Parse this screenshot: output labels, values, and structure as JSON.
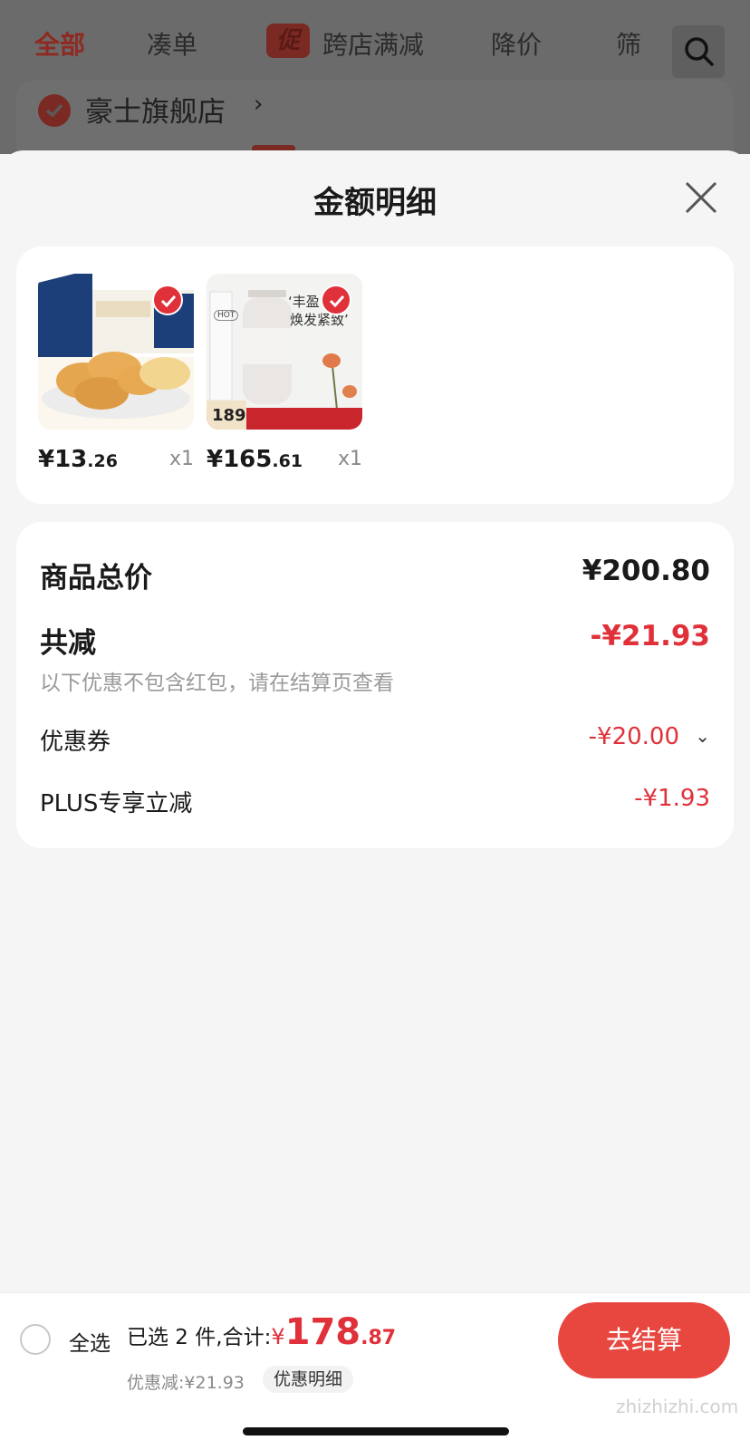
{
  "background": {
    "tabs": [
      {
        "label": "全部",
        "active": true
      },
      {
        "label": "凑单",
        "active": false
      },
      {
        "label": "跨店满减",
        "active": false
      },
      {
        "label": "降价",
        "active": false
      },
      {
        "label": "筛",
        "active": false
      }
    ],
    "promo_badge": "促",
    "store_name": "豪士旗舰店",
    "store_arrow": "›"
  },
  "sheet": {
    "title": "金额明细",
    "products": [
      {
        "price_int": "¥13",
        "price_dec": ".26",
        "qty": "x1",
        "image": "bread-product-image"
      },
      {
        "price_int": "¥165",
        "price_dec": ".61",
        "qty": "x1",
        "image": "shampoo-product-image",
        "image_text": [
          "‘丰盈",
          "焕发紧致’",
          "HOT",
          "189"
        ]
      }
    ],
    "summary": {
      "total_label": "商品总价",
      "total_value": "¥200.80",
      "minus_label": "共减",
      "minus_value": "-¥21.93",
      "note": "以下优惠不包含红包，请在结算页查看",
      "coupon_label": "优惠券",
      "coupon_value": "-¥20.00",
      "plus_label": "PLUS专享立减",
      "plus_value": "-¥1.93"
    }
  },
  "bottom": {
    "select_all": "全选",
    "selected_text": "已选 2 件,合计:",
    "currency": "¥",
    "amount_int": "178",
    "amount_dec": ".87",
    "discount_text": "优惠减:¥21.93",
    "detail_label": "优惠明细",
    "checkout_label": "去结算"
  },
  "watermark": "zhizhizhi.com",
  "colors": {
    "accent": "#e0313a",
    "checkout": "#e8473f",
    "overlay": "#6b6b6b"
  }
}
